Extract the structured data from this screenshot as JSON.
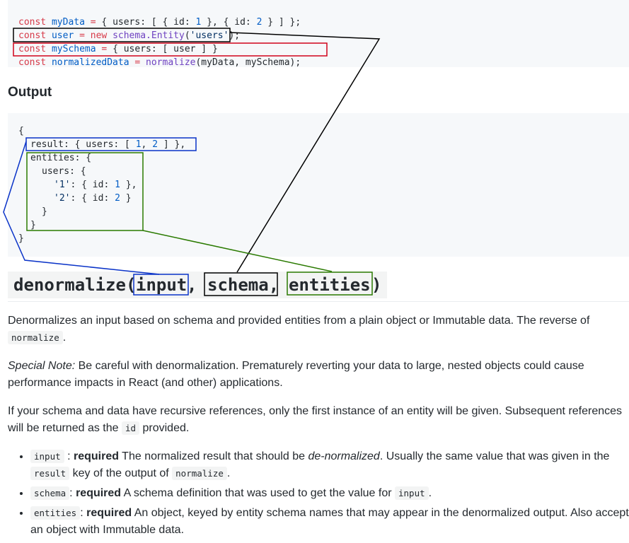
{
  "example_code": {
    "line1": [
      "const",
      "myData",
      "=",
      "{ users: [ { id:",
      "1",
      "}, { id:",
      "2",
      "} ] };"
    ],
    "line2": [
      "const",
      "user",
      "=",
      "new",
      "schema.Entity",
      "(",
      "'users'",
      ");"
    ],
    "line3": [
      "const",
      "mySchema",
      "=",
      "{ users: [ user ] }"
    ],
    "line4": [
      "const",
      "normalizedData",
      "=",
      "normalize",
      "(myData, mySchema);"
    ]
  },
  "output_heading": "Output",
  "output_code": {
    "l1": "{",
    "l2": [
      "result",
      ": { users: [",
      "1",
      ",",
      "2",
      "] },"
    ],
    "l3": [
      "entities",
      ": {"
    ],
    "l4": [
      "users",
      ": {"
    ],
    "l5": [
      "'1'",
      ": { id:",
      "1",
      "},"
    ],
    "l6": [
      "'2'",
      ": { id:",
      "2",
      "}"
    ],
    "l7": "}",
    "l8": "}",
    "l9": "}"
  },
  "api": {
    "fn": "denormalize(",
    "arg1": "input",
    "comma1": ",",
    "arg2": "schema,",
    "arg3": "entities",
    "close": ")"
  },
  "desc": {
    "p1_text": "Denormalizes an input based on schema and provided entities from a plain object or Immutable data. The reverse of",
    "p1_code": "normalize",
    "p1_end": ".",
    "p2_em": "Special Note:",
    "p2_text": "Be careful with denormalization. Prematurely reverting your data to large, nested objects could cause performance impacts in React (and other) applications.",
    "p3_text": "If your schema and data have recursive references, only the first instance of an entity will be given. Subsequent references will be returned as the",
    "p3_code": "id",
    "p3_end": "provided."
  },
  "params": [
    {
      "code": "input",
      "sep": ":",
      "req": "required",
      "t1": "The normalized result that should be",
      "em": "de-normalized",
      "t2": ". Usually the same value that was given in the",
      "c2": "result",
      "t3": "key of the output of",
      "c3": "normalize",
      "t4": "."
    },
    {
      "code": "schema",
      "sep": ":",
      "req": "required",
      "t1": "A schema definition that was used to get the value for",
      "c2": "input",
      "t2": "."
    },
    {
      "code": "entities",
      "sep": ":",
      "req": "required",
      "t1": "An object, keyed by entity schema names that may appear in the denormalized output. Also accepts an object with Immutable data."
    }
  ],
  "colors": {
    "keyword": "#d73a49",
    "variable": "#005cc5",
    "function": "#6f42c1",
    "string": "#032f62",
    "code_bg": "#f6f8fa",
    "annotation_black": "#000000",
    "annotation_red": "#d0021b",
    "annotation_blue": "#0a33c8",
    "annotation_green": "#2a7a00"
  }
}
